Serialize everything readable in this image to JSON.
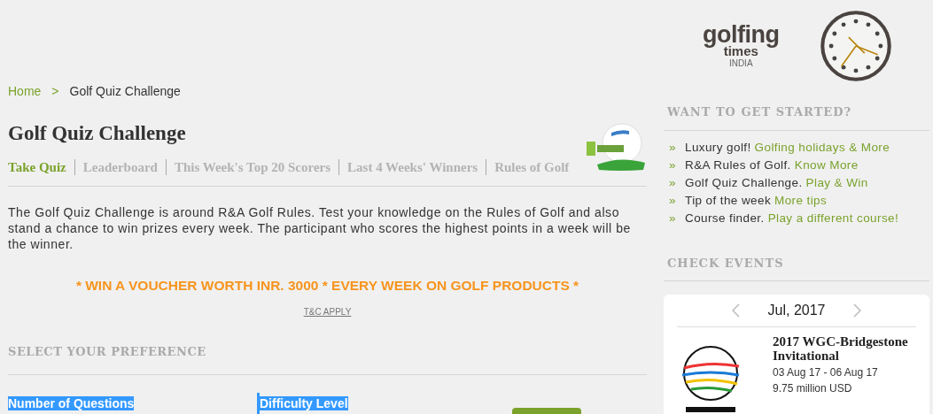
{
  "header": {
    "logo": {
      "word": "golfing",
      "subword": "times",
      "region": "INDIA"
    }
  },
  "breadcrumb": [
    {
      "label": "Home",
      "kind": "link"
    },
    {
      "label": ">",
      "kind": "separator"
    },
    {
      "label": "Golf Quiz Challenge",
      "kind": "current"
    }
  ],
  "page_title": "Golf Quiz Challenge",
  "tabs": [
    {
      "label": "Take Quiz",
      "selected": true
    },
    {
      "label": "Leaderboard",
      "selected": false
    },
    {
      "label": "This Week's Top 20 Scorers",
      "selected": false
    },
    {
      "label": "Last 4 Weeks' Winners",
      "selected": false
    },
    {
      "label": "Rules of Golf",
      "selected": false
    }
  ],
  "intro": "The Golf Quiz Challenge is around R&A Golf Rules. Test your knowledge on the Rules of Golf and also stand a chance to win prizes every week. The participant who scores the highest points in a week will be the winner.",
  "promo": "* WIN A VOUCHER WORTH INR. 3000 * EVERY WEEK ON GOLF PRODUCTS *",
  "terms_link": "T&C APPLY",
  "preference": {
    "heading": "SELECT YOUR PREFERENCE",
    "fields": [
      {
        "label": "Number of Questions"
      },
      {
        "label": "Difficulty Level"
      }
    ]
  },
  "sidebar": {
    "get_started": {
      "heading": "WANT TO GET STARTED?",
      "items": [
        {
          "marker": "»",
          "text": "Luxury golf! ",
          "link": "Golfing holidays & More"
        },
        {
          "marker": "»",
          "text": "R&A Rules of Golf. ",
          "link": "Know More"
        },
        {
          "marker": "»",
          "text": "Golf Quiz Challenge. ",
          "link": "Play & Win"
        },
        {
          "marker": "»",
          "text": "Tip of the week ",
          "link": "More tips"
        },
        {
          "marker": "»",
          "text": "Course finder.",
          "link": "Play a different course!"
        }
      ]
    },
    "events": {
      "heading": "CHECK EVENTS",
      "month": "Jul, 2017",
      "event": {
        "title": "2017 WGC-Bridgestone Invitational",
        "dates": "03 Aug 17 - 06 Aug 17",
        "prize": "9.75 million USD"
      }
    }
  }
}
